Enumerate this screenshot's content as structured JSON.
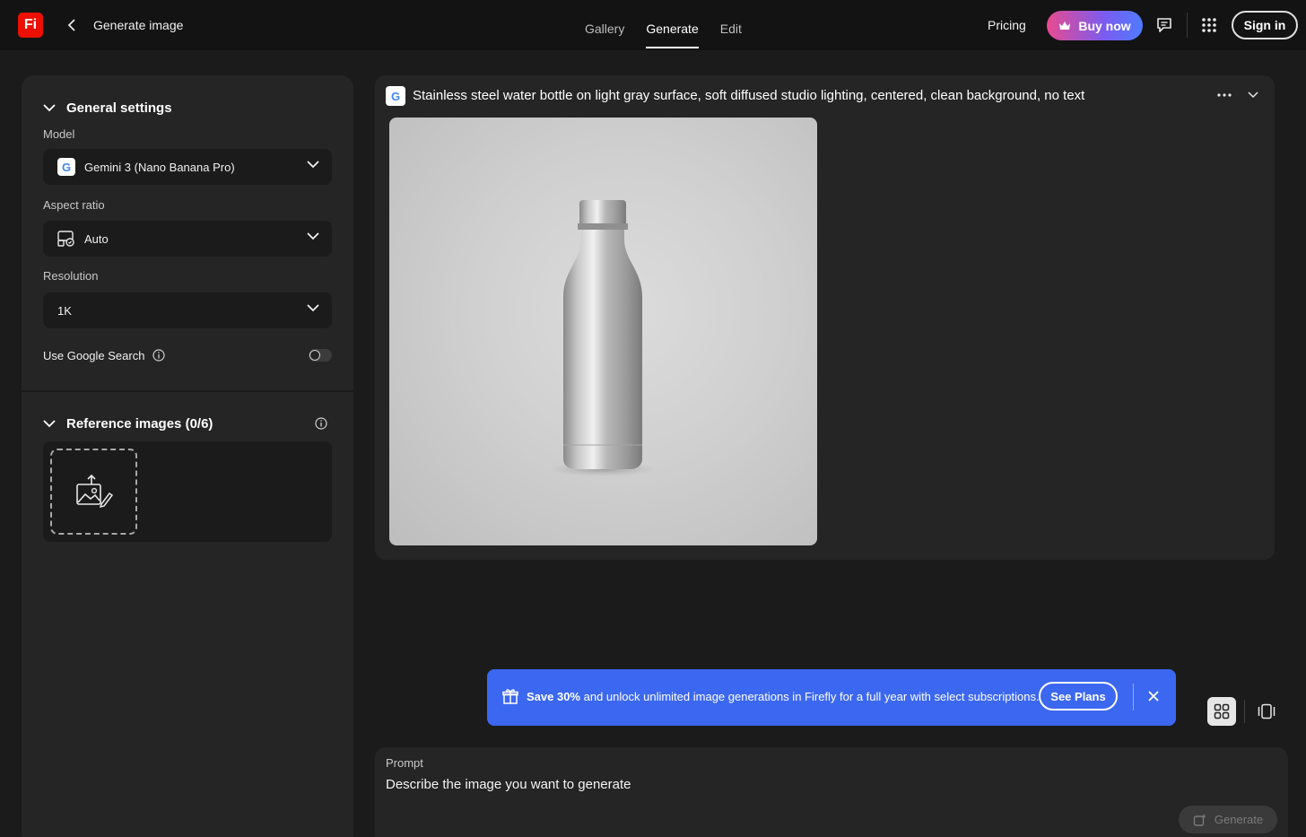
{
  "header": {
    "logo_text": "Fi",
    "page_title": "Generate image",
    "tabs": [
      {
        "label": "Gallery",
        "active": false
      },
      {
        "label": "Generate",
        "active": true
      },
      {
        "label": "Edit",
        "active": false
      }
    ],
    "pricing_label": "Pricing",
    "buy_label": "Buy now",
    "signin_label": "Sign in"
  },
  "settings": {
    "section_title": "General settings",
    "model_label": "Model",
    "model_value": "Gemini 3 (Nano Banana Pro)",
    "aspect_label": "Aspect ratio",
    "aspect_value": "Auto",
    "resolution_label": "Resolution",
    "resolution_value": "1K",
    "google_search_label": "Use Google Search",
    "google_search_enabled": false
  },
  "reference": {
    "title": "Reference images (0/6)"
  },
  "result": {
    "model_badge": "G",
    "prompt": "Stainless steel water bottle on light gray surface, soft diffused studio lighting, centered, clean background, no text"
  },
  "promo": {
    "bold": "Save 30%",
    "text": " and unlock unlimited image generations in Firefly for a full year with select subscriptions.",
    "button": "See Plans"
  },
  "prompt_box": {
    "label": "Prompt",
    "placeholder": "Describe the image you want to generate",
    "generate_label": "Generate"
  },
  "colors": {
    "accent_blue": "#3c67f0",
    "brand_red": "#eb1000",
    "background": "#1b1b1b",
    "panel": "#252525"
  }
}
